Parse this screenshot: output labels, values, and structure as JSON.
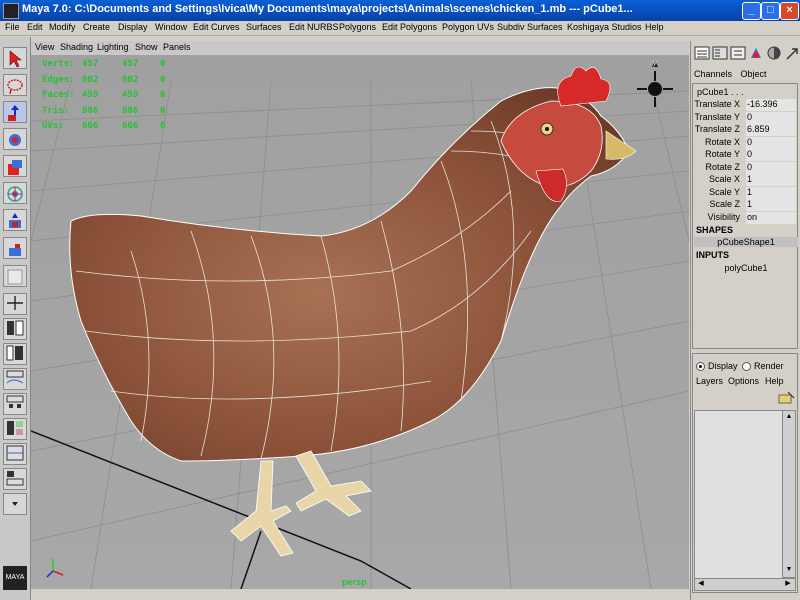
{
  "window": {
    "title": "Maya 7.0: C:\\Documents and Settings\\Ivica\\My Documents\\maya\\projects\\Animals\\scenes\\chicken_1.mb   ---   pCube1..."
  },
  "menu": [
    "File",
    "Edit",
    "Modify",
    "Create",
    "Display",
    "Window",
    "Edit Curves",
    "Surfaces",
    "Edit NURBS",
    "Polygons",
    "Edit Polygons",
    "Polygon UVs",
    "Subdiv Surfaces",
    "Koshigaya Studios",
    "Help"
  ],
  "viewport_menu": [
    "View",
    "Shading",
    "Lighting",
    "Show",
    "Panels"
  ],
  "hud": [
    {
      "label": "Verts:",
      "v1": "457",
      "v2": "457",
      "v3": "0"
    },
    {
      "label": "Edges:",
      "v1": "902",
      "v2": "902",
      "v3": "0"
    },
    {
      "label": "Faces:",
      "v1": "459",
      "v2": "459",
      "v3": "0"
    },
    {
      "label": "Tris:",
      "v1": "886",
      "v2": "886",
      "v3": "0"
    },
    {
      "label": "UVs:",
      "v1": "666",
      "v2": "666",
      "v3": "0"
    }
  ],
  "camera_label": "persp",
  "channel_box": {
    "tabs": [
      "Channels",
      "Object"
    ],
    "object": "pCube1 . . .",
    "attributes": [
      {
        "name": "Translate X",
        "value": "-16.396"
      },
      {
        "name": "Translate Y",
        "value": "0"
      },
      {
        "name": "Translate Z",
        "value": "6.859"
      },
      {
        "name": "Rotate X",
        "value": "0"
      },
      {
        "name": "Rotate Y",
        "value": "0"
      },
      {
        "name": "Rotate Z",
        "value": "0"
      },
      {
        "name": "Scale X",
        "value": "1"
      },
      {
        "name": "Scale Y",
        "value": "1"
      },
      {
        "name": "Scale Z",
        "value": "1"
      },
      {
        "name": "Visibility",
        "value": "on"
      }
    ],
    "shapes_header": "SHAPES",
    "shape": "pCubeShape1",
    "inputs_header": "INPUTS",
    "input": "polyCube1"
  },
  "layer_editor": {
    "display": "Display",
    "render": "Render",
    "menu": [
      "Layers",
      "Options",
      "Help"
    ]
  },
  "logo_text": "MAYA"
}
